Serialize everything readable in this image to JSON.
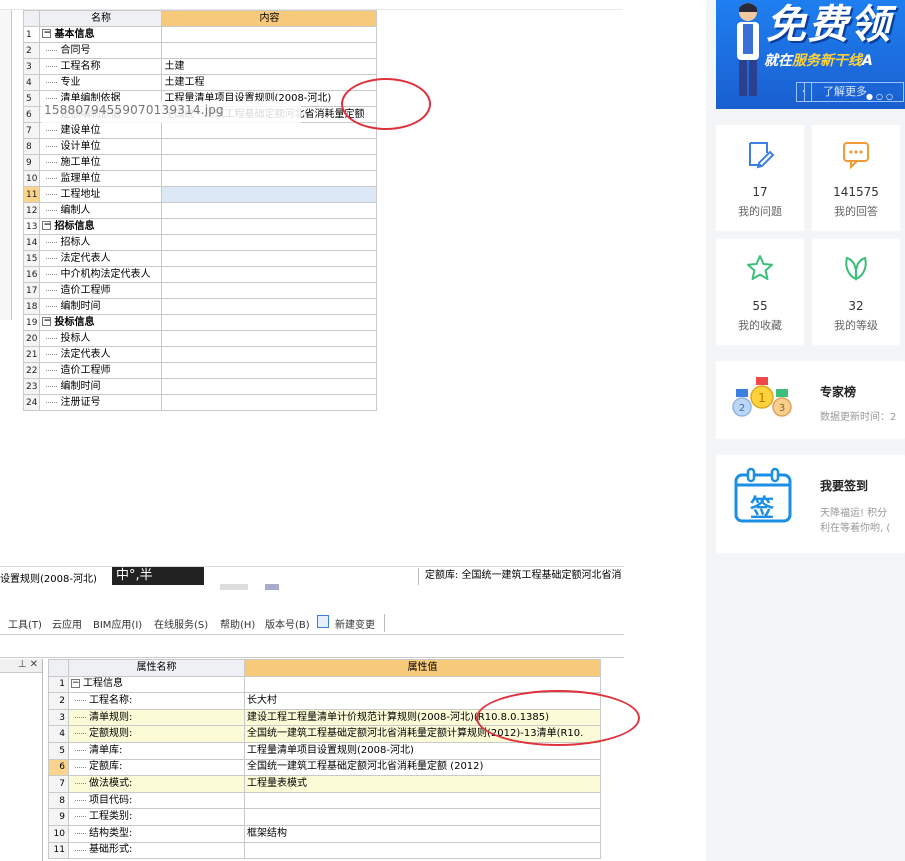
{
  "grid1": {
    "col_name": "名称",
    "col_value": "内容",
    "rows": [
      {
        "num": "1",
        "name": "基本信息",
        "value": "",
        "group": true
      },
      {
        "num": "2",
        "name": "合同号",
        "value": ""
      },
      {
        "num": "3",
        "name": "工程名称",
        "value": "土建"
      },
      {
        "num": "4",
        "name": "专业",
        "value": "土建工程"
      },
      {
        "num": "5",
        "name": "清单编制依据",
        "value": "工程量清单项目设置规则(2008-河北)"
      },
      {
        "num": "6",
        "name": "定额编制依据",
        "value": "全国统一建筑工程基础定额河北省消耗量定额"
      },
      {
        "num": "7",
        "name": "建设单位",
        "value": ""
      },
      {
        "num": "8",
        "name": "设计单位",
        "value": ""
      },
      {
        "num": "9",
        "name": "施工单位",
        "value": ""
      },
      {
        "num": "10",
        "name": "监理单位",
        "value": ""
      },
      {
        "num": "11",
        "name": "工程地址",
        "value": "",
        "selected": true
      },
      {
        "num": "12",
        "name": "编制人",
        "value": ""
      },
      {
        "num": "13",
        "name": "招标信息",
        "value": "",
        "group": true
      },
      {
        "num": "14",
        "name": "招标人",
        "value": ""
      },
      {
        "num": "15",
        "name": "法定代表人",
        "value": ""
      },
      {
        "num": "16",
        "name": "中介机构法定代表人",
        "value": ""
      },
      {
        "num": "17",
        "name": "造价工程师",
        "value": ""
      },
      {
        "num": "18",
        "name": "编制时间",
        "value": ""
      },
      {
        "num": "19",
        "name": "投标信息",
        "value": "",
        "group": true
      },
      {
        "num": "20",
        "name": "投标人",
        "value": ""
      },
      {
        "num": "21",
        "name": "法定代表人",
        "value": ""
      },
      {
        "num": "22",
        "name": "造价工程师",
        "value": ""
      },
      {
        "num": "23",
        "name": "编制时间",
        "value": ""
      },
      {
        "num": "24",
        "name": "注册证号",
        "value": ""
      }
    ]
  },
  "overlay_filename": "15880794559070139314.jpg",
  "status": {
    "left": "设置规则(2008-河北)",
    "ime": "中°,半",
    "right": "定额库: 全国统一建筑工程基础定额河北省消"
  },
  "menu": {
    "tools": "工具(T)",
    "cloud": "云应用",
    "bim": "BIM应用(I)",
    "online": "在线服务(S)",
    "help": "帮助(H)",
    "version": "版本号(B)",
    "new_change": "新建变更"
  },
  "panel2_side_controls": "⊥ ✕",
  "grid2": {
    "col_name": "属性名称",
    "col_value": "属性值",
    "rows": [
      {
        "num": "1",
        "name": "工程信息",
        "value": "",
        "group": true
      },
      {
        "num": "2",
        "name": "工程名称:",
        "value": "长大村"
      },
      {
        "num": "3",
        "name": "清单规则:",
        "value": "建设工程工程量清单计价规范计算规则(2008-河北)(R10.8.0.1385)",
        "yellow": true
      },
      {
        "num": "4",
        "name": "定额规则:",
        "value": "全国统一建筑工程基础定额河北省消耗量定额计算规则(2012)-13清单(R10.",
        "yellow": true
      },
      {
        "num": "5",
        "name": "清单库:",
        "value": "工程量清单项目设置规则(2008-河北)"
      },
      {
        "num": "6",
        "name": "定额库:",
        "value": "全国统一建筑工程基础定额河北省消耗量定额 (2012)",
        "selected": true
      },
      {
        "num": "7",
        "name": "做法模式:",
        "value": "工程量表模式",
        "yellow": true
      },
      {
        "num": "8",
        "name": "项目代码:",
        "value": ""
      },
      {
        "num": "9",
        "name": "工程类别:",
        "value": ""
      },
      {
        "num": "10",
        "name": "结构类型:",
        "value": "框架结构"
      },
      {
        "num": "11",
        "name": "基础形式:",
        "value": ""
      }
    ]
  },
  "sidebar": {
    "banner": {
      "big_text": "免费领",
      "sub_text_a": "就在",
      "sub_text_b": "服务新干线",
      "sub_text_c": "A",
      "button": "了解更多",
      "prev": "‹"
    },
    "stats": [
      {
        "icon": "edit-icon",
        "value": "17",
        "label": "我的问题",
        "color": "#3d7fe0"
      },
      {
        "icon": "chat-icon",
        "value": "141575",
        "label": "我的回答",
        "color": "#f29a38"
      },
      {
        "icon": "star-icon",
        "value": "55",
        "label": "我的收藏",
        "color": "#3cbf7a"
      },
      {
        "icon": "leaf-icon",
        "value": "32",
        "label": "我的等级",
        "color": "#3cbf7a"
      }
    ],
    "experts": {
      "title": "专家榜",
      "desc": "数据更新时间：2"
    },
    "checkin": {
      "title": "我要签到",
      "icon_text": "签",
      "desc1": "天降福运! 积分",
      "desc2": "利在等着你哟, ("
    }
  }
}
